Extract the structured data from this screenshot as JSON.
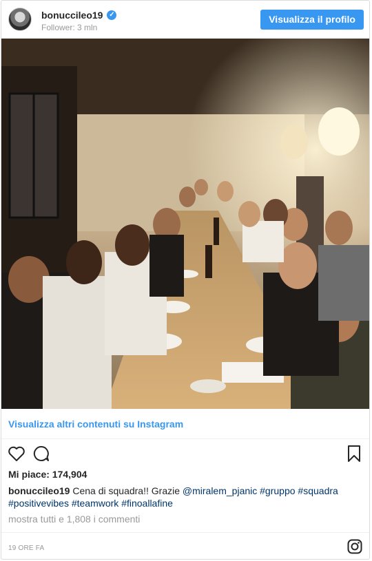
{
  "header": {
    "username": "bonucci​leo19",
    "followers": "Follower: 3 mln",
    "profile_button": "Visualizza il profilo",
    "verified_icon": "verified-badge-icon"
  },
  "more_link": "Visualizza altri contenuti su Instagram",
  "likes": "Mi piace: 174,904",
  "caption": {
    "username": "bonucci​leo19",
    "text": " Cena di squadra!! Grazie ",
    "mention": "@miralem_pjanic",
    "hashtags": [
      "#gruppo",
      "#squadra",
      "#positivevibes",
      "#teamwork",
      "#finoallafine"
    ]
  },
  "comments_link": "mostra tutti e 1,808 i commenti",
  "timestamp": "19 ORE FA",
  "colors": {
    "accent": "#3897f0",
    "text": "#262626",
    "muted": "#999999",
    "hashtag": "#003569"
  },
  "icons": [
    "heart-icon",
    "comment-icon",
    "bookmark-icon",
    "instagram-glyph-icon"
  ]
}
